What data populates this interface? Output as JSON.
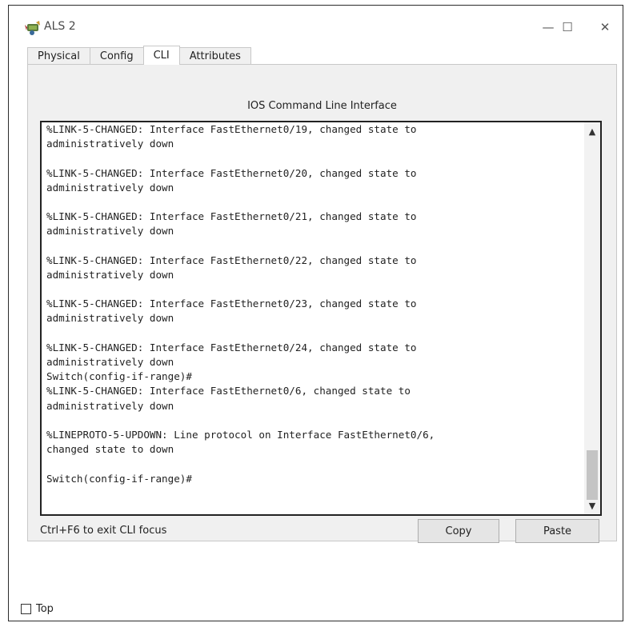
{
  "window": {
    "title": "ALS 2",
    "minimize_glyph": "—",
    "maximize_glyph": "☐",
    "close_glyph": "✕"
  },
  "tabs": [
    {
      "label": "Physical"
    },
    {
      "label": "Config"
    },
    {
      "label": "CLI",
      "active": true
    },
    {
      "label": "Attributes"
    }
  ],
  "cli": {
    "panel_title": "IOS Command Line Interface",
    "lines": [
      "%LINK-5-CHANGED: Interface FastEthernet0/19, changed state to",
      "administratively down",
      "",
      "%LINK-5-CHANGED: Interface FastEthernet0/20, changed state to",
      "administratively down",
      "",
      "%LINK-5-CHANGED: Interface FastEthernet0/21, changed state to",
      "administratively down",
      "",
      "%LINK-5-CHANGED: Interface FastEthernet0/22, changed state to",
      "administratively down",
      "",
      "%LINK-5-CHANGED: Interface FastEthernet0/23, changed state to",
      "administratively down",
      "",
      "%LINK-5-CHANGED: Interface FastEthernet0/24, changed state to",
      "administratively down",
      "Switch(config-if-range)#",
      "%LINK-5-CHANGED: Interface FastEthernet0/6, changed state to",
      "administratively down",
      "",
      "%LINEPROTO-5-UPDOWN: Line protocol on Interface FastEthernet0/6,",
      "changed state to down",
      "",
      "Switch(config-if-range)#"
    ],
    "scroll_up_glyph": "▲",
    "scroll_down_glyph": "▼",
    "exit_hint": "Ctrl+F6 to exit CLI focus",
    "copy_label": "Copy",
    "paste_label": "Paste"
  },
  "footer": {
    "top_label": "Top",
    "top_checked": false
  },
  "colors": {
    "window_border": "#2b2b2b",
    "panel_bg": "#f0f0f0",
    "terminal_bg": "#ffffff",
    "terminal_text": "#222222"
  }
}
